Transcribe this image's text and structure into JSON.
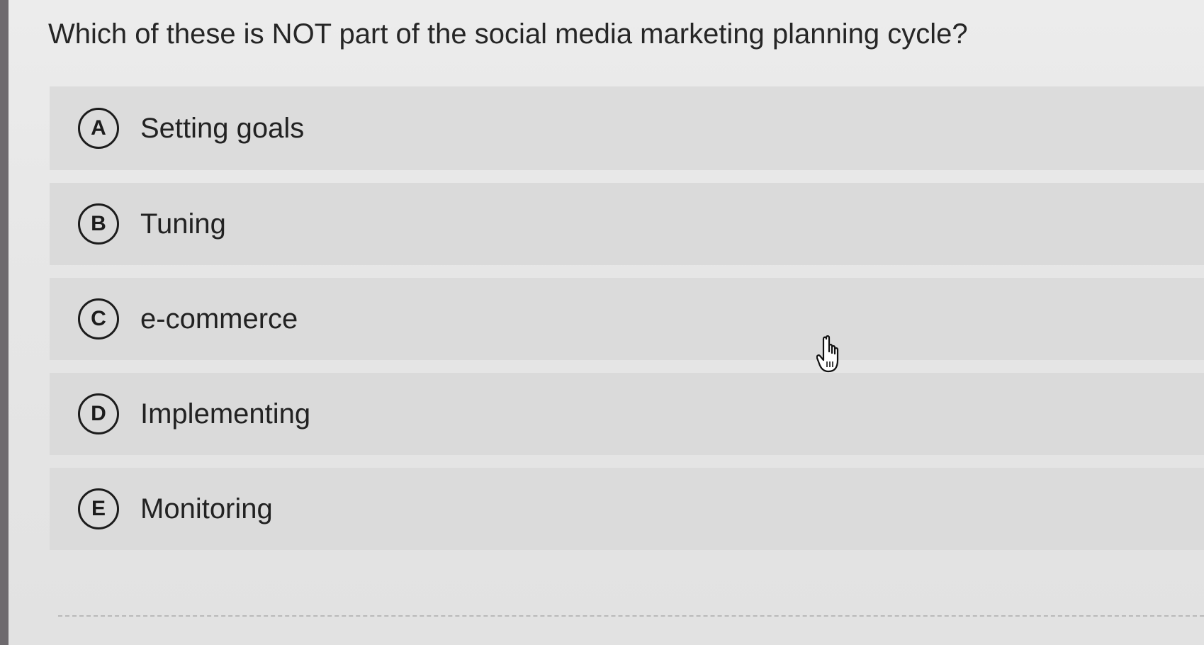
{
  "question": {
    "text": "Which of these is NOT part of the social media marketing planning cycle?"
  },
  "options": [
    {
      "letter": "A",
      "text": "Setting goals"
    },
    {
      "letter": "B",
      "text": "Tuning"
    },
    {
      "letter": "C",
      "text": "e-commerce"
    },
    {
      "letter": "D",
      "text": "Implementing"
    },
    {
      "letter": "E",
      "text": "Monitoring"
    }
  ],
  "cursor": {
    "icon": "hand-pointer-icon"
  }
}
